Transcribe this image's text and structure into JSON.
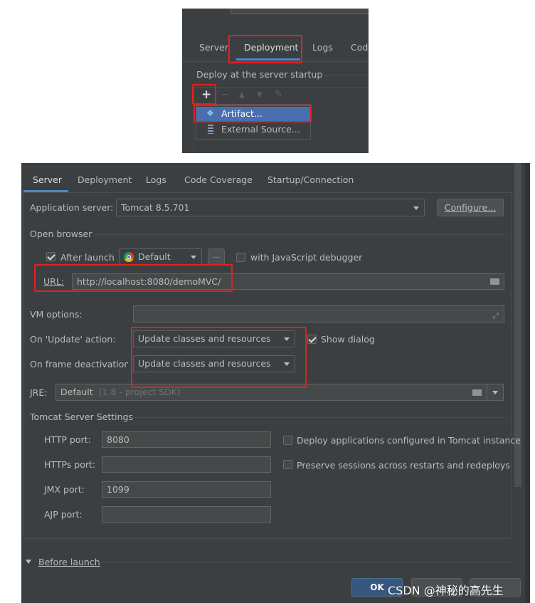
{
  "top_panel": {
    "tabs": [
      "Server",
      "Deployment",
      "Logs",
      "Cod"
    ],
    "active_tab": "Deployment",
    "deploy_label": "Deploy at the server startup",
    "toolbar": {
      "add": "+",
      "remove": "−",
      "up": "▲",
      "down": "▼",
      "edit": "✎"
    },
    "menu_items": [
      "Artifact...",
      "External Source..."
    ]
  },
  "main_panel": {
    "tabs": [
      "Server",
      "Deployment",
      "Logs",
      "Code Coverage",
      "Startup/Connection"
    ],
    "active_tab": "Server",
    "app_server_label": "Application server:",
    "app_server_value": "Tomcat 8.5.701",
    "configure_button": "Configure...",
    "open_browser_label": "Open browser",
    "after_launch_label": "After launch",
    "after_launch_checked": true,
    "browser_value": "Default",
    "more_button": "...",
    "js_debugger_label": "with JavaScript debugger",
    "js_debugger_checked": false,
    "url_label": "URL:",
    "url_value": "http://localhost:8080/demoMVC/",
    "vm_options_label": "VM options:",
    "vm_options_value": "",
    "on_update_label": "On 'Update' action:",
    "on_update_value": "Update classes and resources",
    "show_dialog_label": "Show dialog",
    "show_dialog_checked": true,
    "on_frame_label": "On frame deactivation:",
    "on_frame_value": "Update classes and resources",
    "jre_label": "JRE:",
    "jre_value": "Default",
    "jre_hint": "(1.8 - project SDK)",
    "tomcat_settings_label": "Tomcat Server Settings",
    "http_port_label": "HTTP port:",
    "http_port_value": "8080",
    "https_port_label": "HTTPs port:",
    "https_port_value": "",
    "jmx_port_label": "JMX port:",
    "jmx_port_value": "1099",
    "ajp_port_label": "AJP port:",
    "ajp_port_value": "",
    "deploy_apps_label": "Deploy applications configured in Tomcat instance",
    "deploy_apps_checked": false,
    "preserve_sessions_label": "Preserve sessions across restarts and redeploys",
    "preserve_sessions_checked": false,
    "before_launch_label": "Before launch",
    "ok_button": "OK"
  },
  "watermark": "CSDN @神秘的高先生",
  "colors": {
    "panel_bg": "#3c3f41",
    "input_bg": "#45494a",
    "selection": "#4b6eaf",
    "tab_underline": "#4a88c7",
    "highlight_border": "#e3201f",
    "text": "#bbbbbb"
  }
}
